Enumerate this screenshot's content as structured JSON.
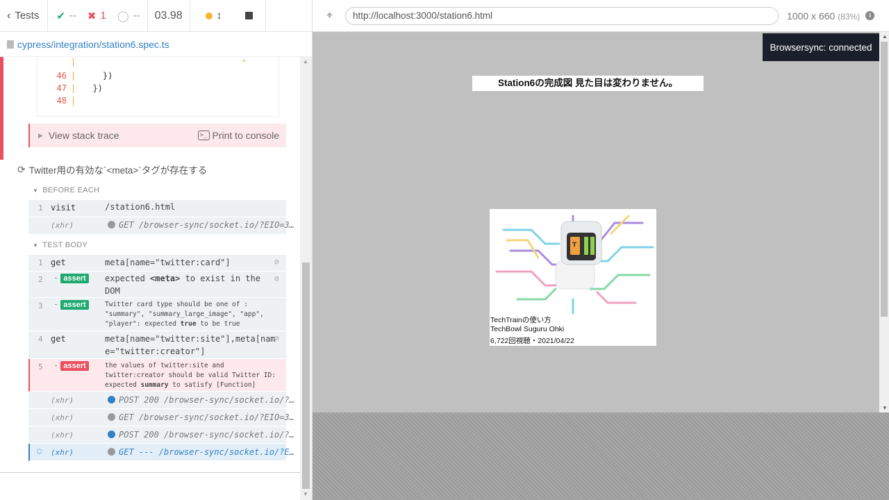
{
  "header": {
    "tests_label": "Tests",
    "passed": "--",
    "failed": "1",
    "pending": "--",
    "duration": "03.98"
  },
  "spec": {
    "path": "cypress/integration/station6.spec.ts"
  },
  "codeframe": {
    "lines": [
      {
        "num": "",
        "code": ""
      },
      {
        "num": "46",
        "code": "    })"
      },
      {
        "num": "47",
        "code": "  })"
      },
      {
        "num": "48",
        "code": ""
      }
    ],
    "caret": "^"
  },
  "stack": {
    "view_label": "View stack trace",
    "print_label": "Print to console",
    "term_icon": ">_"
  },
  "test": {
    "title": "Twitter用の有効な`<meta>`タグが存在する"
  },
  "hooks": {
    "before_each": "BEFORE EACH",
    "test_body": "TEST BODY"
  },
  "before_each_cmds": [
    {
      "num": "1",
      "name": "visit",
      "msg": "/station6.html"
    },
    {
      "num": "",
      "name": "(xhr)",
      "msg": "GET /browser-sync/socket.io/?EIO=3…"
    }
  ],
  "body_cmds": {
    "c1": {
      "num": "1",
      "name": "get",
      "msg": "meta[name=\"twitter:card\"]"
    },
    "c2": {
      "num": "2",
      "badge": "assert",
      "msg1": "expected ",
      "msg2": "<meta>",
      "msg3": " to exist in the",
      "msg4": "DOM"
    },
    "c3": {
      "num": "3",
      "badge": "assert",
      "l1": "Twitter card type should be one of :",
      "l2": "\"summary\", \"summary_large_image\", \"app\",",
      "l3a": "\"player\": expected ",
      "l3b": "true",
      "l3c": " to be true"
    },
    "c4": {
      "num": "4",
      "name": "get",
      "l1": "meta[name=\"twitter:site\"],meta[nam",
      "l2": "e=\"twitter:creator\"]"
    },
    "c5": {
      "num": "5",
      "badge": "assert",
      "l1": "the values of twitter:site and",
      "l2": "twitter:creator should be valid Twitter ID:",
      "l3a": "expected ",
      "l3b": "summary",
      "l3c": " to satisfy [Function]"
    },
    "x1": {
      "name": "(xhr)",
      "msg": "POST 200 /browser-sync/socket.io/?…"
    },
    "x2": {
      "name": "(xhr)",
      "msg": "GET /browser-sync/socket.io/?EIO=3…"
    },
    "x3": {
      "name": "(xhr)",
      "msg": "POST 200 /browser-sync/socket.io/?…"
    },
    "x4": {
      "name": "(xhr)",
      "msg": "GET --- /browser-sync/socket.io/?E…"
    }
  },
  "aut": {
    "url": "http://localhost:3000/station6.html",
    "viewport": "1000 x 660",
    "scale": "(83%)",
    "browsersync": "Browsersync: connected",
    "heading": "Station6の完成図 見た目は変わりません。",
    "card": {
      "title": "TechTrainの使い方",
      "channel": "TechBowl Suguru Ohki",
      "meta": "6,722回視聴・2021/04/22"
    }
  },
  "colors": {
    "pass": "#1fa971",
    "fail": "#e94f5f",
    "accent": "#3380c4"
  }
}
